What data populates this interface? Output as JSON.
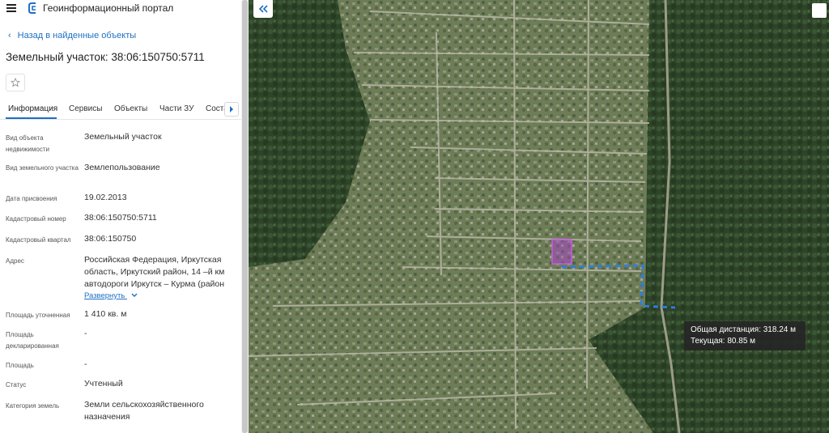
{
  "header": {
    "app_title": "Геоинформационный портал"
  },
  "nav": {
    "back_label": "Назад в найденные объекты",
    "back_chevron": "‹"
  },
  "object": {
    "title": "Земельный участок: 38:06:150750:5711"
  },
  "tabs": [
    {
      "label": "Информация",
      "active": true
    },
    {
      "label": "Сервисы",
      "active": false
    },
    {
      "label": "Объекты",
      "active": false
    },
    {
      "label": "Части ЗУ",
      "active": false
    },
    {
      "label": "Соста",
      "active": false
    }
  ],
  "fields": [
    {
      "label": "Вид объекта недвижимости",
      "value": "Земельный участок"
    },
    {
      "label": "Вид земельного участка",
      "value": "Землепользование"
    },
    {
      "label": "Дата присвоения",
      "value": "19.02.2013"
    },
    {
      "label": "Кадастровый номер",
      "value": "38:06:150750:5711"
    },
    {
      "label": "Кадастровый квартал",
      "value": "38:06:150750"
    },
    {
      "label": "Адрес",
      "value": "Российская Федерация, Иркутская область, Иркутский район, 14 –й км автодороги Иркутск – Курма (район"
    },
    {
      "label": "Площадь уточненная",
      "value": "1 410 кв. м"
    },
    {
      "label": "Площадь декларированная",
      "value": "-"
    },
    {
      "label": "Площадь",
      "value": "-"
    },
    {
      "label": "Статус",
      "value": "Учтенный"
    },
    {
      "label": "Категория земель",
      "value": "Земли сельскохозяйственного назначения"
    }
  ],
  "expand_label": "Развернуть",
  "measure": {
    "total_label": "Общая дистанция: 318.24 м",
    "current_label": "Текущая: 80.85 м"
  },
  "colors": {
    "accent": "#1e6fc4",
    "measure_line": "#2d7fd9",
    "parcel": "#b23bd6",
    "forest": "#2f4a2a",
    "settlement": "#6f7d59"
  },
  "icons": {
    "menu": "hamburger-icon",
    "logo": "portal-logo-icon",
    "favorite": "star-icon",
    "tabs_next": "chevron-right-icon",
    "collapse": "double-chevron-left-icon"
  }
}
